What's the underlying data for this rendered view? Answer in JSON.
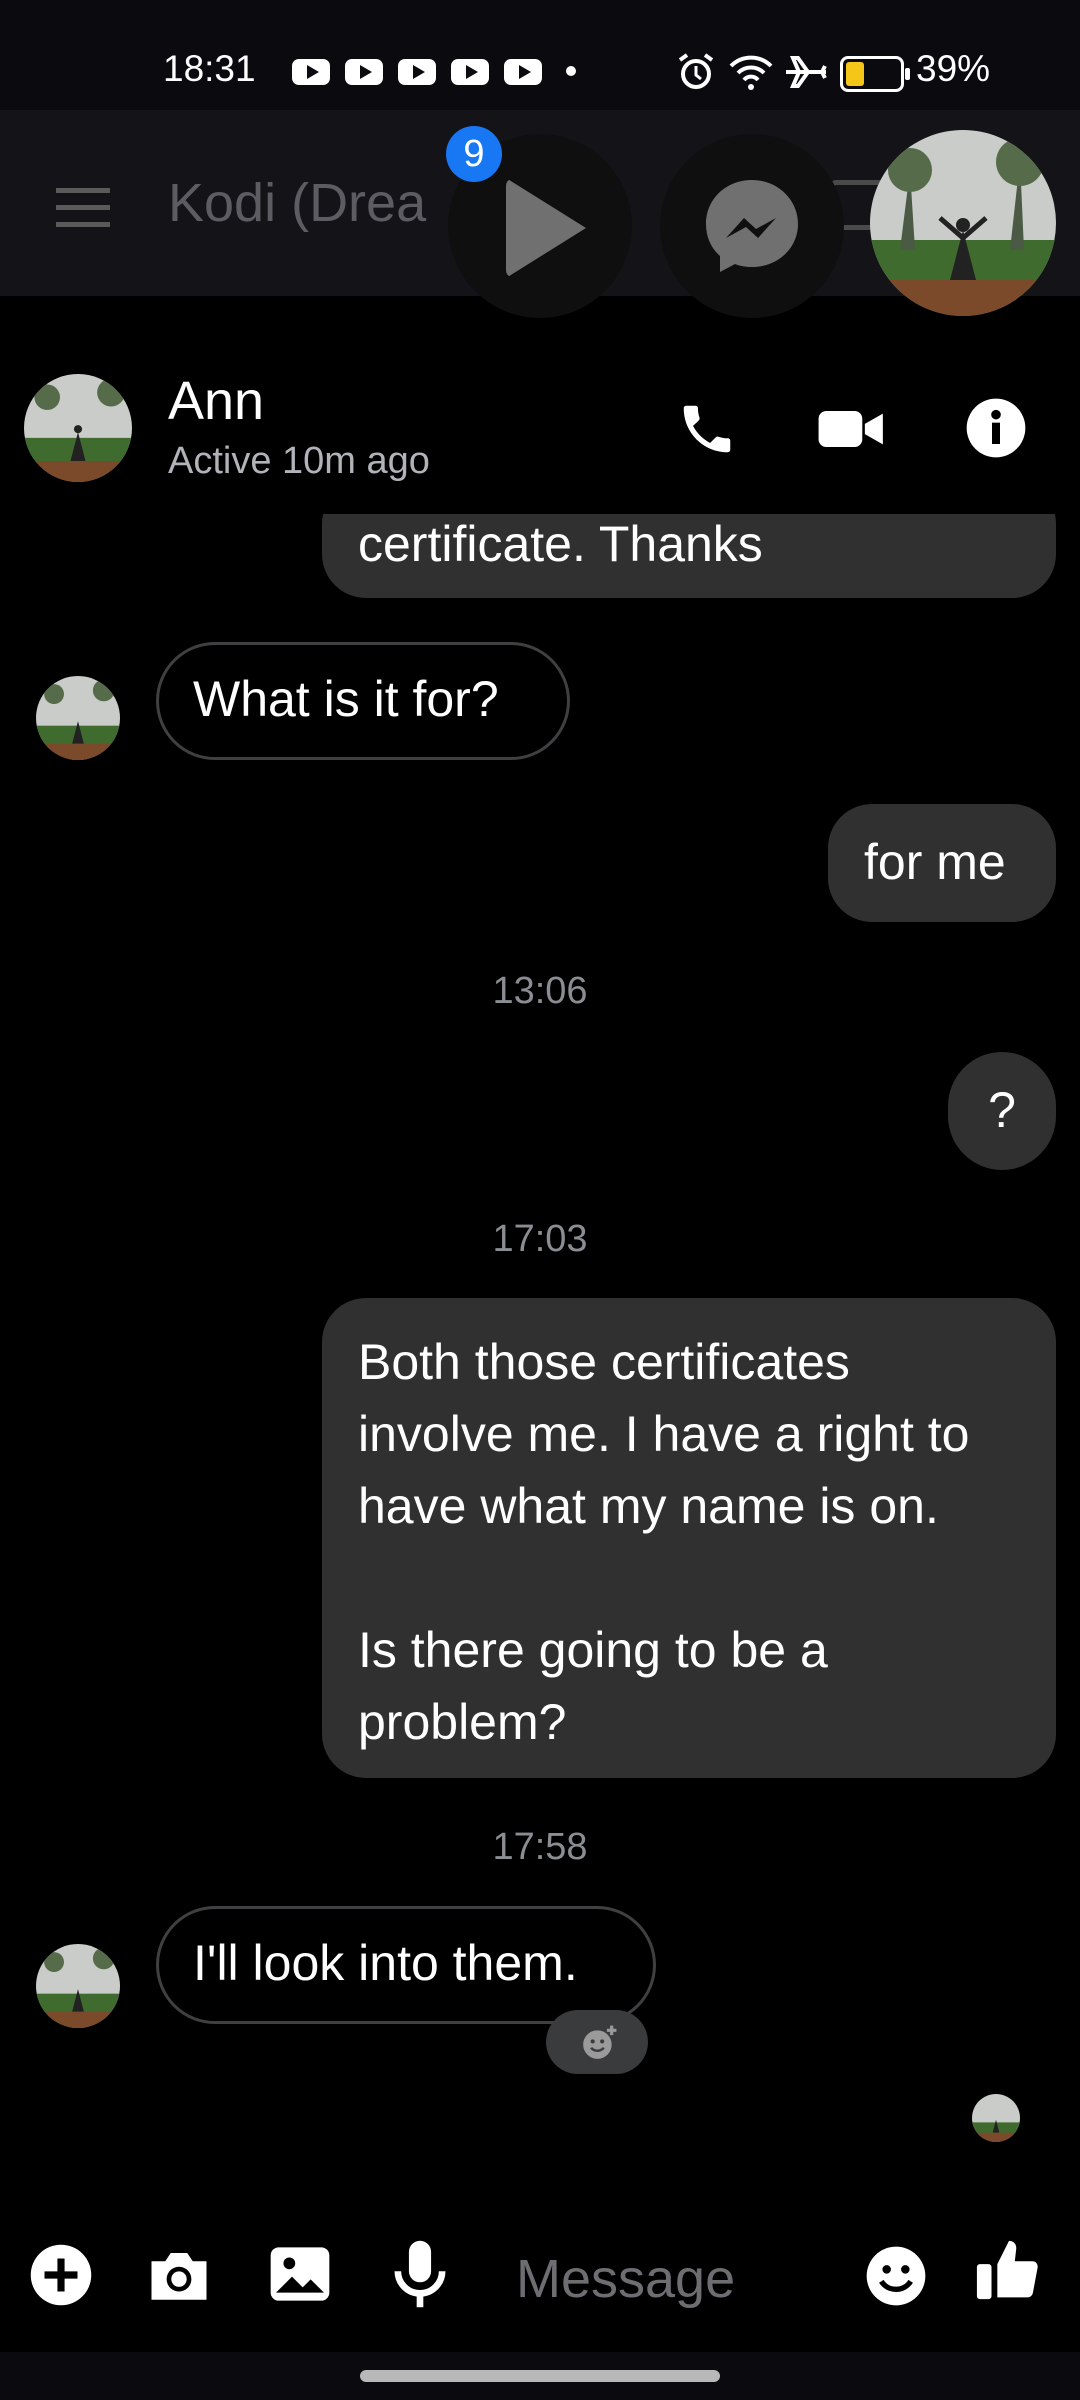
{
  "status_bar": {
    "time": "18:31",
    "battery_percent": "39%",
    "icons": [
      "youtube-icon",
      "youtube-icon",
      "youtube-icon",
      "youtube-icon",
      "youtube-icon",
      "alarm-icon",
      "wifi-icon",
      "airplane-icon",
      "battery-icon"
    ]
  },
  "background_app": {
    "title": "Kodi (Drea"
  },
  "chat_heads": {
    "unread_badge": "9"
  },
  "conversation": {
    "contact_name": "Ann",
    "contact_status": "Active 10m ago",
    "actions": [
      "phone-icon",
      "video-icon",
      "info-icon"
    ]
  },
  "messages": [
    {
      "from": "me",
      "text": "certificate. Thanks"
    },
    {
      "from": "them",
      "text": "What is it for?"
    },
    {
      "from": "me",
      "text": "for me"
    },
    {
      "timestamp": "13:06"
    },
    {
      "from": "me",
      "text": "?"
    },
    {
      "timestamp": "17:03"
    },
    {
      "from": "me",
      "lines": [
        "Both those certificates",
        "involve me. I have a right to",
        "have what my name is on.",
        "",
        "Is there going to be a",
        "problem?"
      ]
    },
    {
      "timestamp": "17:58"
    },
    {
      "from": "them",
      "text": "I'll look into them."
    }
  ],
  "composer": {
    "placeholder": "Message"
  },
  "colors": {
    "background": "#000000",
    "sent_bubble": "#303030",
    "received_border": "#3e4042",
    "badge": "#1877f2",
    "battery_fill": "#f5c518"
  }
}
